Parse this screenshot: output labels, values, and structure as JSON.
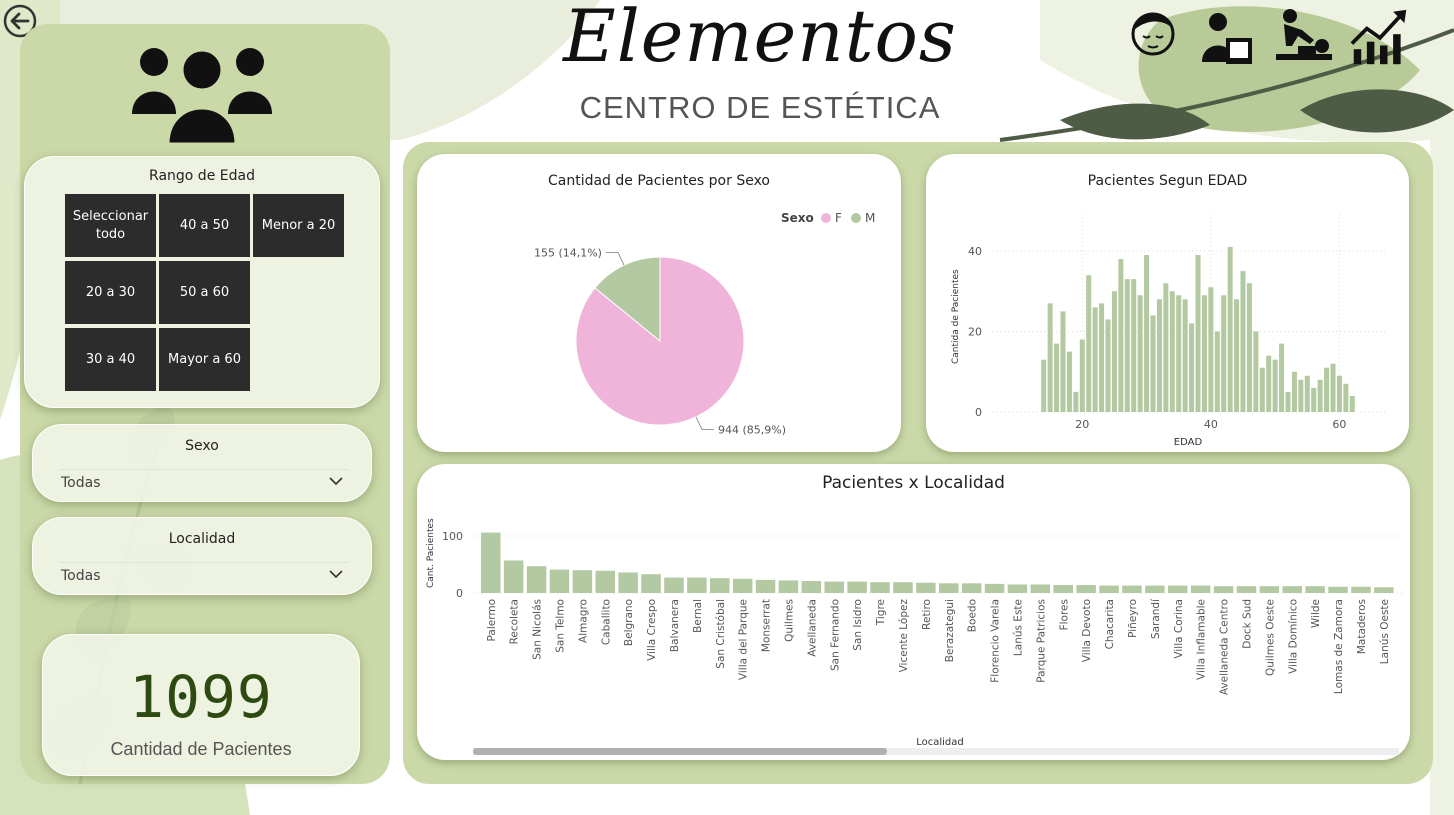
{
  "header": {
    "title": "Elementos",
    "subtitle": "CENTRO DE ESTÉTICA"
  },
  "nav": {
    "items": [
      {
        "name": "facial-icon"
      },
      {
        "name": "receptionist-icon"
      },
      {
        "name": "massage-icon"
      },
      {
        "name": "growth-chart-icon"
      }
    ]
  },
  "icons": {
    "back": "back-arrow-icon",
    "patients": "people-group-icon",
    "chevron": "chevron-down-icon"
  },
  "filters": {
    "age": {
      "title": "Rango de Edad",
      "options": [
        "Seleccionar todo",
        "40 a 50",
        "Menor a 20",
        "20 a 30",
        "50 a 60",
        "30 a 40",
        "Mayor a 60"
      ]
    },
    "sex": {
      "title": "Sexo",
      "value": "Todas"
    },
    "locality": {
      "title": "Localidad",
      "value": "Todas"
    }
  },
  "kpi": {
    "value": "1099",
    "label": "Cantidad de Pacientes"
  },
  "colors": {
    "female": "#f0b4da",
    "male": "#b3c9a1",
    "bar": "#b3c9a1",
    "panel": "#cbd9a8",
    "dark_button": "#2c2c2c"
  },
  "chart_data": [
    {
      "type": "pie",
      "title": "Cantidad de Pacientes por Sexo",
      "legend_title": "Sexo",
      "legend_position": "top-right",
      "slices": [
        {
          "name": "F",
          "value": 944,
          "label": "944 (85,9%)"
        },
        {
          "name": "M",
          "value": 155,
          "label": "155 (14,1%)"
        }
      ]
    },
    {
      "type": "bar",
      "title": "Pacientes Segun EDAD",
      "xlabel": "EDAD",
      "ylabel": "Cantida de Pacientes",
      "x_ticks": [
        20,
        40,
        60
      ],
      "y_ticks": [
        0,
        20,
        40
      ],
      "ylim": [
        0,
        42
      ],
      "grid": true,
      "x": [
        14,
        15,
        16,
        17,
        18,
        19,
        20,
        21,
        22,
        23,
        24,
        25,
        26,
        27,
        28,
        29,
        30,
        31,
        32,
        33,
        34,
        35,
        36,
        37,
        38,
        39,
        40,
        41,
        42,
        43,
        44,
        45,
        46,
        47,
        48,
        49,
        50,
        51,
        52,
        53,
        54,
        55,
        56,
        57,
        58,
        59,
        60,
        61,
        62,
        63
      ],
      "values": [
        13,
        27,
        17,
        25,
        15,
        5,
        18,
        34,
        26,
        27,
        23,
        30,
        38,
        33,
        33,
        29,
        39,
        24,
        28,
        32,
        30,
        29,
        28,
        22,
        39,
        29,
        31,
        20,
        29,
        41,
        28,
        35,
        32,
        20,
        11,
        14,
        13,
        17,
        5,
        10,
        8,
        9,
        6,
        8,
        11,
        12,
        9,
        7,
        4,
        0
      ]
    },
    {
      "type": "bar",
      "title": "Pacientes x Localidad",
      "xlabel": "Localidad",
      "ylabel": "Cant. Pacientes",
      "y_ticks": [
        0,
        100
      ],
      "ylim": [
        0,
        110
      ],
      "grid": true,
      "categories": [
        "Palermo",
        "Recoleta",
        "San Nicolás",
        "San Telmo",
        "Almagro",
        "Caballito",
        "Belgrano",
        "Villa Crespo",
        "Balvanera",
        "Bernal",
        "San Cristóbal",
        "Villa del Parque",
        "Monserrat",
        "Quilmes",
        "Avellaneda",
        "San Fernando",
        "San Isidro",
        "Tigre",
        "Vicente López",
        "Retiro",
        "Berazategui",
        "Boedo",
        "Florencio Varela",
        "Lanús Este",
        "Parque Patricios",
        "Flores",
        "Villa Devoto",
        "Chacarita",
        "Piñeyro",
        "Sarandí",
        "Villa Corina",
        "Villa Inflamable",
        "Avellaneda Centro",
        "Dock Sud",
        "Quilmes Oeste",
        "Villa Domínico",
        "Wilde",
        "Lomas de Zamora",
        "Mataderos",
        "Lanús Oeste"
      ],
      "values": [
        106,
        57,
        47,
        41,
        40,
        39,
        36,
        33,
        27,
        27,
        26,
        25,
        23,
        22,
        21,
        20,
        20,
        19,
        19,
        18,
        17,
        17,
        16,
        15,
        15,
        14,
        14,
        13,
        13,
        13,
        13,
        13,
        12,
        12,
        12,
        12,
        12,
        11,
        11,
        10
      ]
    }
  ]
}
